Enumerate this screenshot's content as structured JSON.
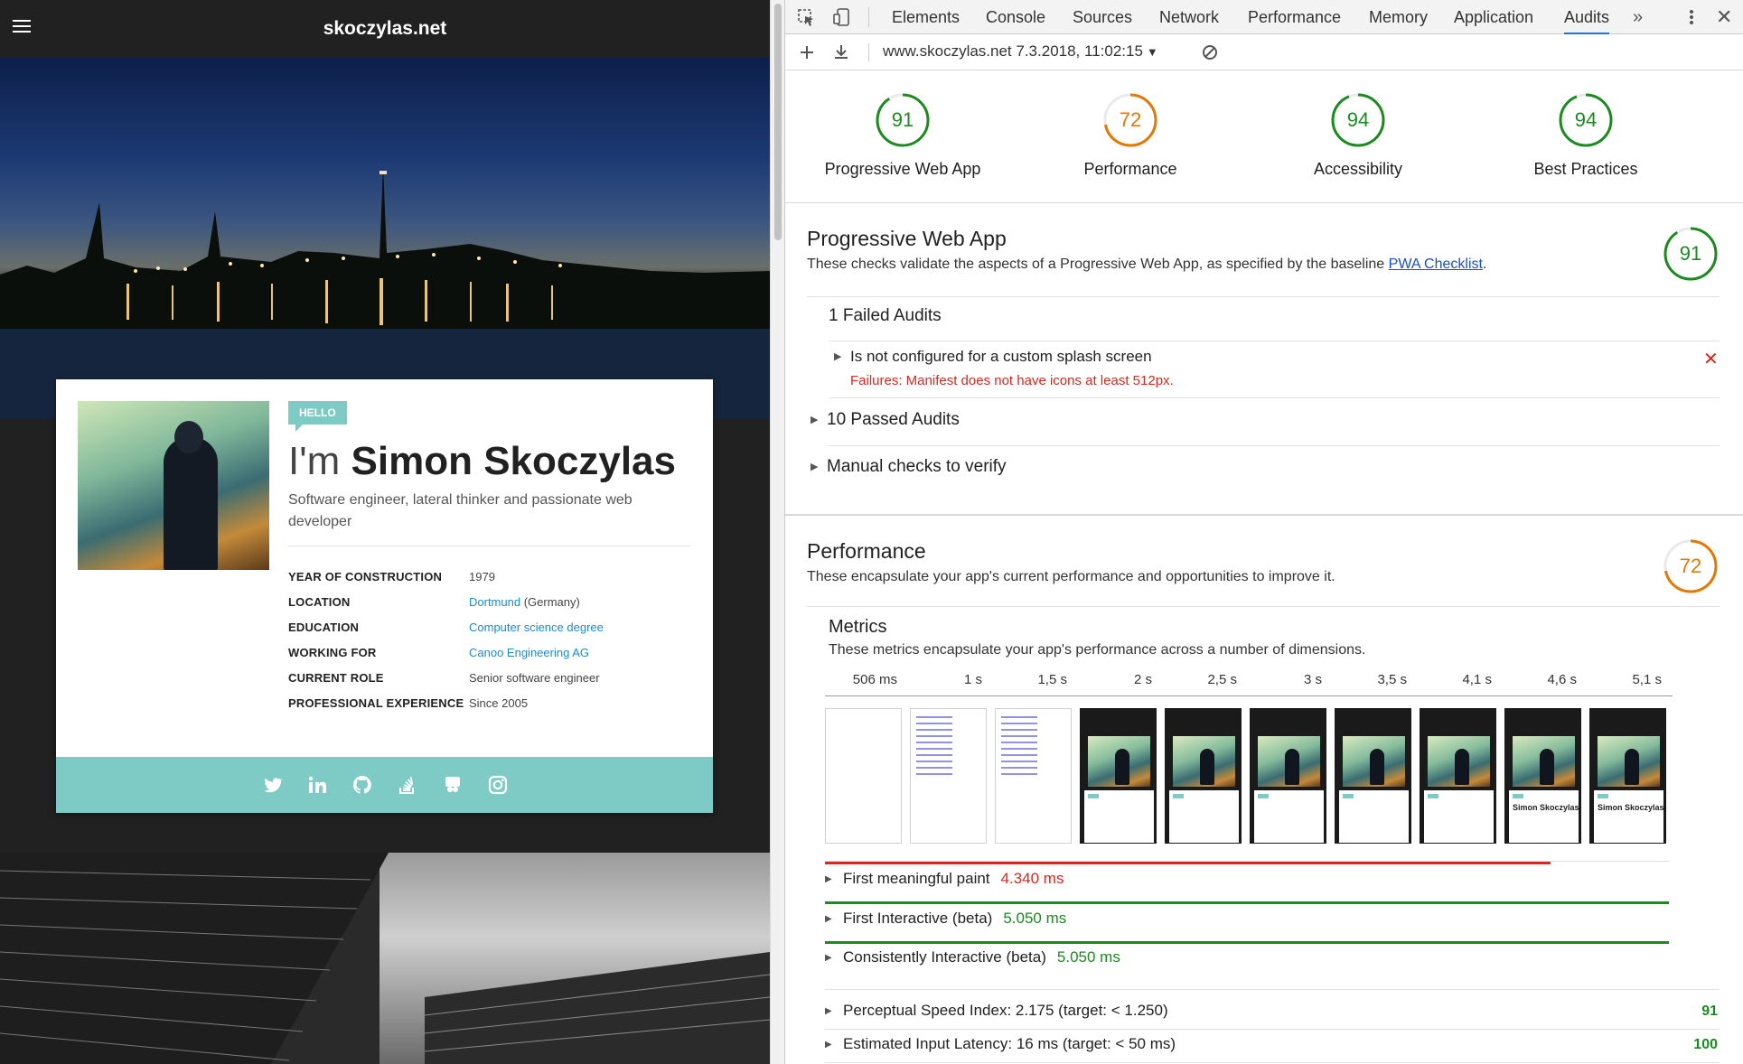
{
  "site": {
    "title": "skoczylas.net",
    "hello": "HELLO",
    "name_prefix": "I'm",
    "name": "Simon Skoczylas",
    "tagline": "Software engineer, lateral thinker and passionate web developer",
    "facts": [
      {
        "key": "YEAR OF CONSTRUCTION",
        "value": "1979",
        "link": "",
        "suffix": ""
      },
      {
        "key": "LOCATION",
        "value": "",
        "link": "Dortmund",
        "suffix": " (Germany)"
      },
      {
        "key": "EDUCATION",
        "value": "",
        "link": "Computer science degree",
        "suffix": ""
      },
      {
        "key": "WORKING FOR",
        "value": "",
        "link": "Canoo Engineering AG",
        "suffix": ""
      },
      {
        "key": "CURRENT ROLE",
        "value": "Senior software engineer",
        "link": "",
        "suffix": ""
      },
      {
        "key": "PROFESSIONAL EXPERIENCE",
        "value": "Since 2005",
        "link": "",
        "suffix": ""
      }
    ],
    "social_icons": [
      "twitter-icon",
      "linkedin-icon",
      "github-icon",
      "stackoverflow-icon",
      "slideshare-icon",
      "instagram-icon"
    ],
    "accent_color": "#7ecbc6"
  },
  "devtools": {
    "tabs": [
      "Elements",
      "Console",
      "Sources",
      "Network",
      "Performance",
      "Memory",
      "Application",
      "Audits"
    ],
    "active_tab": "Audits",
    "report_label": "www.skoczylas.net 7.3.2018, 11:02:15",
    "scores": [
      {
        "label": "Progressive Web App",
        "value": 91,
        "color": "#1b8a1f"
      },
      {
        "label": "Performance",
        "value": 72,
        "color": "#e67700"
      },
      {
        "label": "Accessibility",
        "value": 94,
        "color": "#1b8a1f"
      },
      {
        "label": "Best Practices",
        "value": 94,
        "color": "#1b8a1f"
      }
    ],
    "pwa": {
      "title": "Progressive Web App",
      "desc": "These checks validate the aspects of a Progressive Web App, as specified by the baseline",
      "link": "PWA Checklist",
      "desc_end": ".",
      "score": 91,
      "failed_header": "1 Failed Audits",
      "failed_item": "Is not configured for a custom splash screen",
      "failed_detail": "Failures: Manifest does not have icons at least 512px.",
      "passed": "10 Passed Audits",
      "manual": "Manual checks to verify"
    },
    "perf": {
      "title": "Performance",
      "desc": "These encapsulate your app's current performance and opportunities to improve it.",
      "score": 72,
      "metrics_title": "Metrics",
      "metrics_desc": "These metrics encapsulate your app's performance across a number of dimensions.",
      "timeline_ticks": [
        "506 ms",
        "1 s",
        "1,5 s",
        "2 s",
        "2,5 s",
        "3 s",
        "3,5 s",
        "4,1 s",
        "4,6 s",
        "5,1 s"
      ],
      "frames": [
        "blank",
        "doc",
        "doc",
        "photo",
        "photo",
        "photo",
        "photo",
        "photo",
        "named",
        "named"
      ],
      "frame_name_text": "Simon Skoczylas",
      "metrics": [
        {
          "label": "First meaningful paint",
          "value": "4.340 ms",
          "status": "red",
          "fraction": 0.86
        },
        {
          "label": "First Interactive (beta)",
          "value": "5.050 ms",
          "status": "green",
          "fraction": 1.0
        },
        {
          "label": "Consistently Interactive (beta)",
          "value": "5.050 ms",
          "status": "green",
          "fraction": 1.0
        }
      ],
      "other_metrics": [
        {
          "label": "Perceptual Speed Index: 2.175 (target: < 1.250)",
          "score": "91"
        },
        {
          "label": "Estimated Input Latency: 16 ms (target: < 50 ms)",
          "score": "100"
        }
      ]
    }
  }
}
